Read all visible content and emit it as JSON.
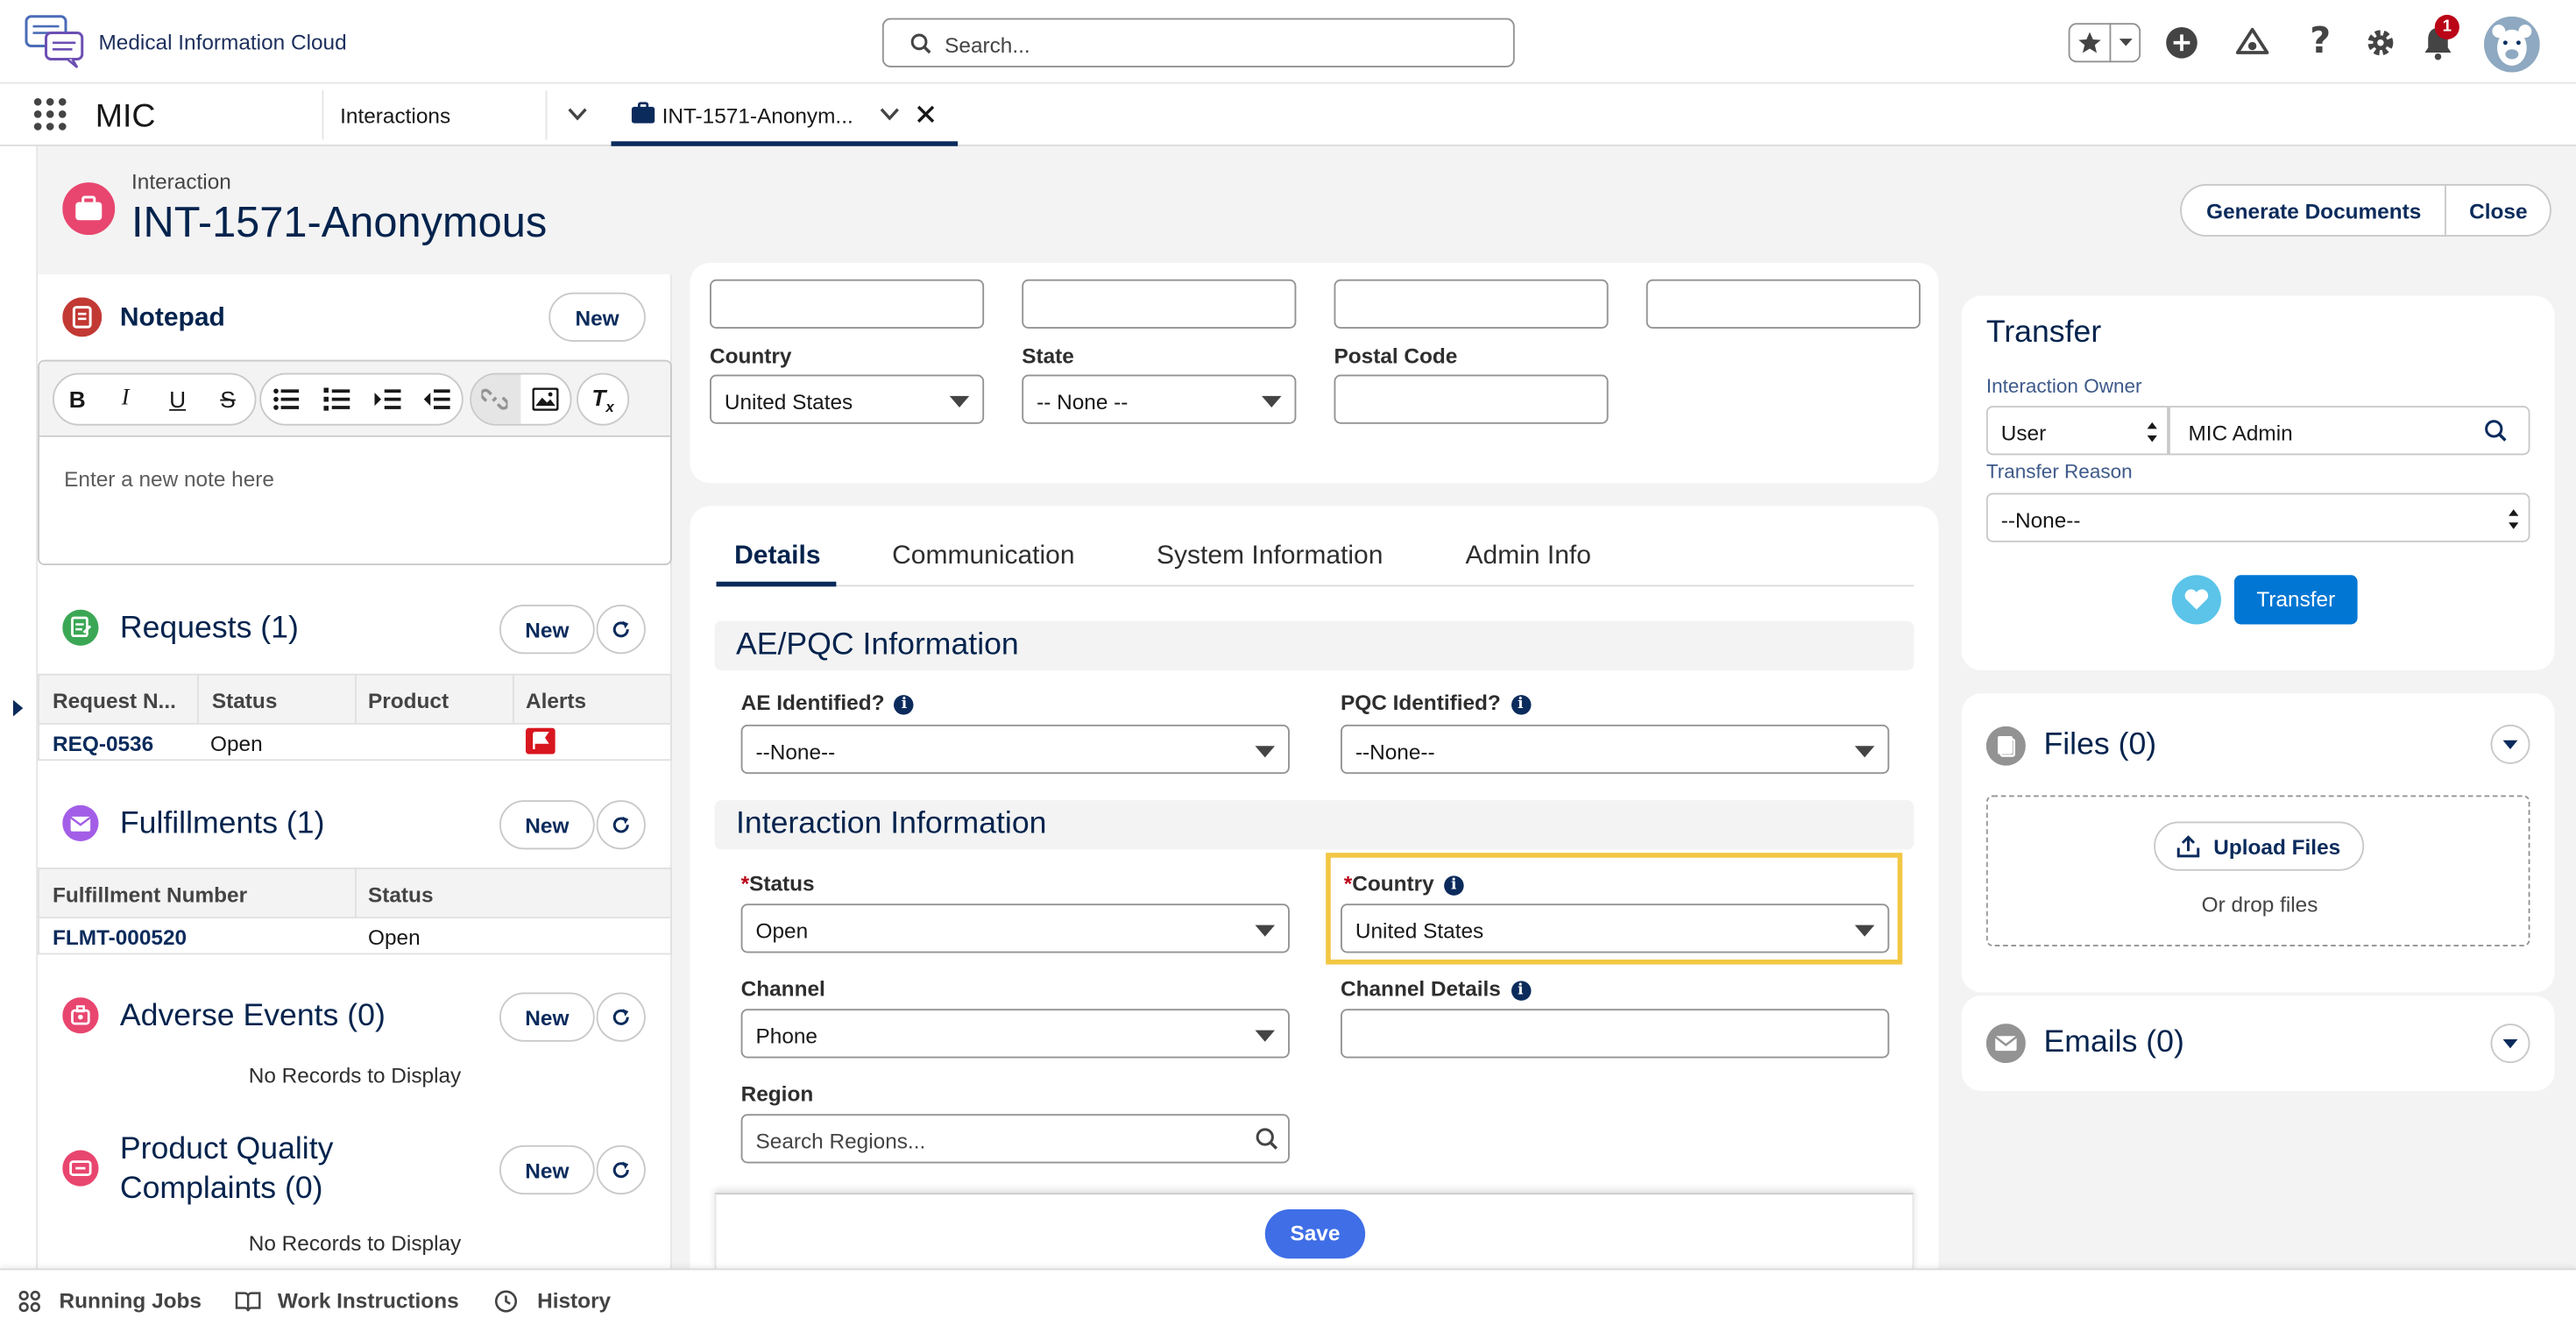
{
  "header": {
    "app_name": "Medical Information Cloud",
    "search_placeholder": "Search...",
    "notification_count": "1"
  },
  "navbar": {
    "app_label": "MIC",
    "tabs": [
      {
        "label": "Interactions"
      },
      {
        "label": "INT-1571-Anonym..."
      }
    ]
  },
  "record": {
    "object_label": "Interaction",
    "title": "INT-1571-Anonymous",
    "actions": {
      "generate": "Generate Documents",
      "close": "Close"
    }
  },
  "notepad": {
    "title": "Notepad",
    "new_label": "New",
    "placeholder": "Enter a new note here",
    "toolbar": [
      "bold",
      "italic",
      "underline",
      "strikethrough",
      "bulleted-list",
      "numbered-list",
      "indent",
      "outdent",
      "link",
      "image",
      "clear-formatting"
    ]
  },
  "requests": {
    "title": "Requests (1)",
    "new_label": "New",
    "columns": [
      "Request N...",
      "Status",
      "Product",
      "Alerts"
    ],
    "rows": [
      {
        "number": "REQ-0536",
        "status": "Open",
        "product": "",
        "alert_color": "#d8161f"
      }
    ]
  },
  "fulfillments": {
    "title": "Fulfillments (1)",
    "new_label": "New",
    "columns": [
      "Fulfillment Number",
      "Status"
    ],
    "rows": [
      {
        "number": "FLMT-000520",
        "status": "Open"
      }
    ]
  },
  "adverse_events": {
    "title": "Adverse Events (0)",
    "new_label": "New",
    "empty": "No Records to Display"
  },
  "pqc": {
    "title_line1": "Product Quality",
    "title_line2": "Complaints (0)",
    "new_label": "New",
    "empty": "No Records to Display"
  },
  "address": {
    "country_label": "Country",
    "country_value": "United States",
    "state_label": "State",
    "state_value": "-- None --",
    "postal_label": "Postal Code",
    "postal_value": ""
  },
  "details": {
    "tabs": [
      "Details",
      "Communication",
      "System Information",
      "Admin Info"
    ],
    "active_tab": "Details",
    "ae_section": "AE/PQC Information",
    "ae_label": "AE Identified?",
    "ae_value": "--None--",
    "pqc_label": "PQC Identified?",
    "pqc_value": "--None--",
    "interaction_section": "Interaction Information",
    "status_label": "Status",
    "status_value": "Open",
    "country_label": "Country",
    "country_value": "United States",
    "channel_label": "Channel",
    "channel_value": "Phone",
    "channel_details_label": "Channel Details",
    "channel_details_value": "",
    "region_label": "Region",
    "region_placeholder": "Search Regions...",
    "save_label": "Save"
  },
  "transfer": {
    "title": "Transfer",
    "owner_label": "Interaction Owner",
    "owner_type": "User",
    "owner_value": "MIC Admin",
    "reason_label": "Transfer Reason",
    "reason_value": "--None--",
    "button_label": "Transfer"
  },
  "files": {
    "title": "Files (0)",
    "upload_label": "Upload Files",
    "drop_label": "Or drop files"
  },
  "emails": {
    "title": "Emails (0)"
  },
  "footer": {
    "items": [
      "Running Jobs",
      "Work Instructions",
      "History"
    ]
  },
  "colors": {
    "brand_navy": "#03234d",
    "button_blue": "#0176d3",
    "save_blue": "#3f6ee6",
    "highlight": "#f2c744"
  }
}
